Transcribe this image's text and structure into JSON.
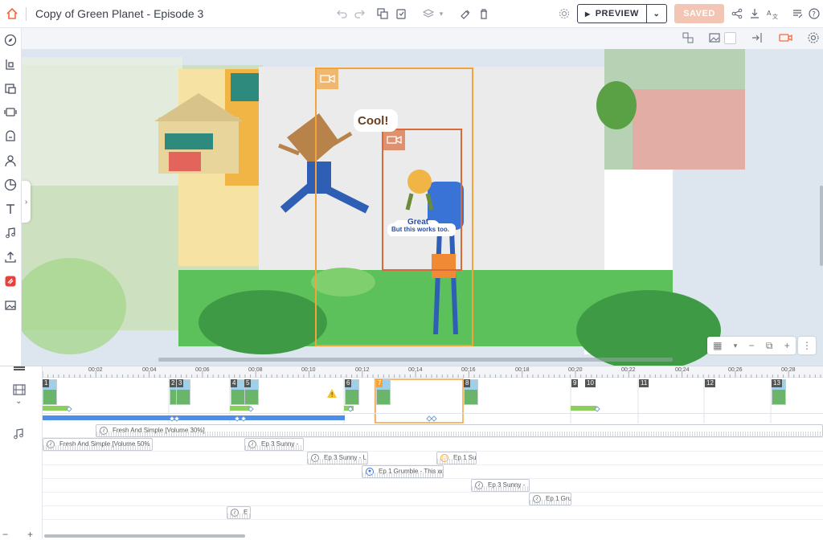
{
  "header": {
    "title": "Copy of Green Planet - Episode 3",
    "preview_label": "PREVIEW",
    "saved_label": "SAVED"
  },
  "canvas": {
    "speech_cool": "Cool!",
    "speech_great": "Great",
    "speech_works": "But this works too."
  },
  "timeline": {
    "ticks": [
      "00:02",
      "00:04",
      "00:06",
      "00:08",
      "00:10",
      "00:12",
      "00:14",
      "00:16",
      "00:18",
      "00:20",
      "00:22",
      "00:24",
      "00:26",
      "00:28"
    ],
    "scene_numbers": [
      "1",
      "2",
      "3",
      "4",
      "5",
      "6",
      "7",
      "8",
      "9",
      "10",
      "11",
      "12",
      "13"
    ],
    "audio_clips": [
      {
        "label": "Fresh And Simple [Volume 30%]"
      },
      {
        "label": "Fresh And Simple [Volume 50%"
      },
      {
        "label": "Ep 3 Sunny -"
      },
      {
        "label": "Ep 3 Sunny - L"
      },
      {
        "label": "Ep 1 Su"
      },
      {
        "label": "Ep 1 Grumble - This w"
      },
      {
        "label": "Ep 3 Sunny -"
      },
      {
        "label": "Ep 1 Gru"
      },
      {
        "label": "E"
      }
    ]
  },
  "colors": {
    "accent": "#f26a3d",
    "saved_bg": "#f3c5b4",
    "selection": "#f2a33a",
    "track_blue": "#4d8ee8",
    "track_green": "#8bd05c"
  },
  "icons": [
    "home-icon",
    "undo-icon",
    "redo-icon",
    "copy-icon",
    "paste-icon",
    "layers-icon",
    "paint-icon",
    "trash-icon",
    "settings-icon",
    "play-icon",
    "chevron-down-icon",
    "share-icon",
    "download-icon",
    "translate-icon",
    "notes-icon",
    "help-icon"
  ]
}
